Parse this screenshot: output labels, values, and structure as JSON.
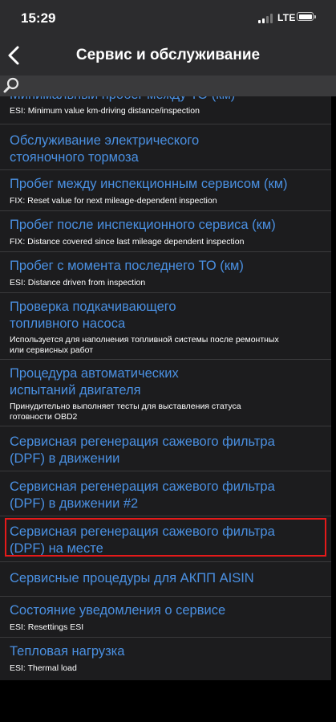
{
  "status_bar": {
    "time": "15:29",
    "network": "LTE"
  },
  "nav": {
    "title": "Сервис и обслуживание",
    "back_icon": "chevron-left-icon"
  },
  "search": {
    "icon": "search-icon",
    "placeholder": ""
  },
  "colors": {
    "link": "#4a90e2",
    "highlight": "#e51a1a",
    "list_bg": "#1c1c1e",
    "bar_bg": "#2c2c2e"
  },
  "items": [
    {
      "title": [
        "Минимальный пробег между ТО (км)"
      ],
      "subtitle": [
        "ESI: Minimum value km-driving distance/inspection"
      ]
    },
    {
      "title": [
        "Обслуживание электрического",
        "стояночного тормоза"
      ],
      "subtitle": []
    },
    {
      "title": [
        "Пробег между инспекционным сервисом (км)"
      ],
      "subtitle": [
        "FIX: Reset value for next mileage-dependent inspection"
      ]
    },
    {
      "title": [
        "Пробег после инспекционного сервиса (км)"
      ],
      "subtitle": [
        "FIX: Distance covered since last mileage dependent inspection"
      ]
    },
    {
      "title": [
        "Пробег с момента последнего ТО (км)"
      ],
      "subtitle": [
        "ESI: Distance driven from inspection"
      ]
    },
    {
      "title": [
        "Проверка подкачивающего",
        "топливного насоса"
      ],
      "subtitle": [
        "Используется для наполнения топливной системы после ремонтных",
        "или сервисных работ"
      ]
    },
    {
      "title": [
        "Процедура автоматических",
        "испытаний двигателя"
      ],
      "subtitle": [
        "Принудительно выполняет тесты для выставления статуса",
        "готовности OBD2"
      ]
    },
    {
      "title": [
        "Сервисная регенерация сажевого фильтра",
        "(DPF) в движении"
      ],
      "subtitle": []
    },
    {
      "title": [
        "Сервисная регенерация сажевого фильтра",
        "(DPF) в движении #2"
      ],
      "subtitle": []
    },
    {
      "title": [
        "Сервисная регенерация сажевого фильтра",
        "(DPF) на месте"
      ],
      "subtitle": [],
      "highlighted": true
    },
    {
      "title": [
        "Сервисные процедуры для АКПП AISIN"
      ],
      "subtitle": []
    },
    {
      "title": [
        "Состояние уведомления о сервисе"
      ],
      "subtitle": [
        "ESI: Resettings ESI"
      ]
    },
    {
      "title": [
        "Тепловая нагрузка"
      ],
      "subtitle": [
        "ESI: Thermal load"
      ]
    }
  ]
}
